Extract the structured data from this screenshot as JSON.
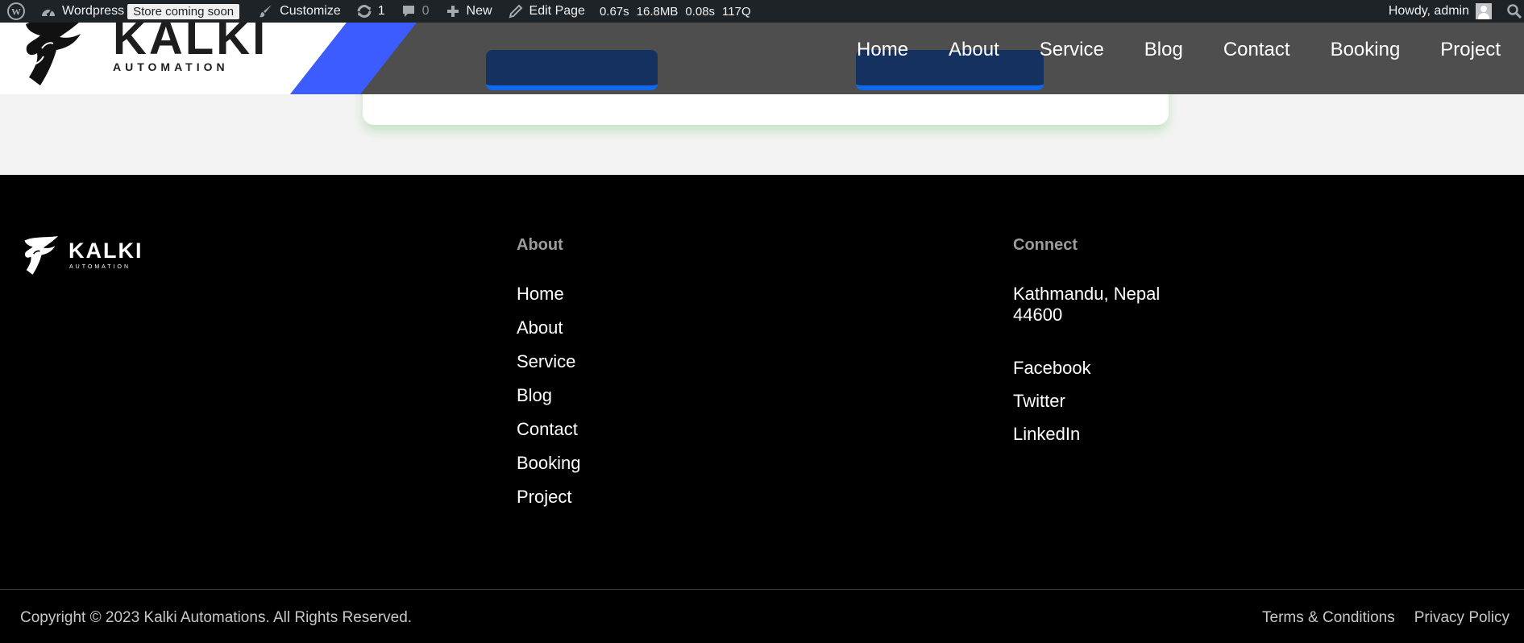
{
  "adminbar": {
    "site_name": "Wordpress",
    "store_badge": "Store coming soon",
    "customize": "Customize",
    "updates_count": "1",
    "comments_count": "0",
    "new_label": "New",
    "edit_page": "Edit Page",
    "perf": [
      "0.67s",
      "16.8MB",
      "0.08s",
      "117Q"
    ],
    "greeting": "Howdy, admin"
  },
  "header": {
    "logo_text": "KALKI",
    "logo_sub": "AUTOMATION",
    "nav": [
      "Home",
      "About",
      "Service",
      "Blog",
      "Contact",
      "Booking",
      "Project"
    ]
  },
  "footer": {
    "logo_text": "KALKI",
    "logo_sub": "AUTOMATION",
    "about_heading": "About",
    "about_links": [
      "Home",
      "About",
      "Service",
      "Blog",
      "Contact",
      "Booking",
      "Project"
    ],
    "connect_heading": "Connect",
    "address_line1": "Kathmandu, Nepal",
    "address_line2": "44600",
    "social_links": [
      "Facebook",
      "Twitter",
      "LinkedIn"
    ],
    "copyright": "Copyright © 2023 Kalki Automations. All Rights Reserved.",
    "terms": "Terms & Conditions",
    "privacy": "Privacy Policy"
  },
  "colors": {
    "admin_bar_bg": "#1d2327",
    "header_bg": "#4e4e4e",
    "accent_blue": "#3d5cff",
    "footer_bg": "#000000"
  }
}
